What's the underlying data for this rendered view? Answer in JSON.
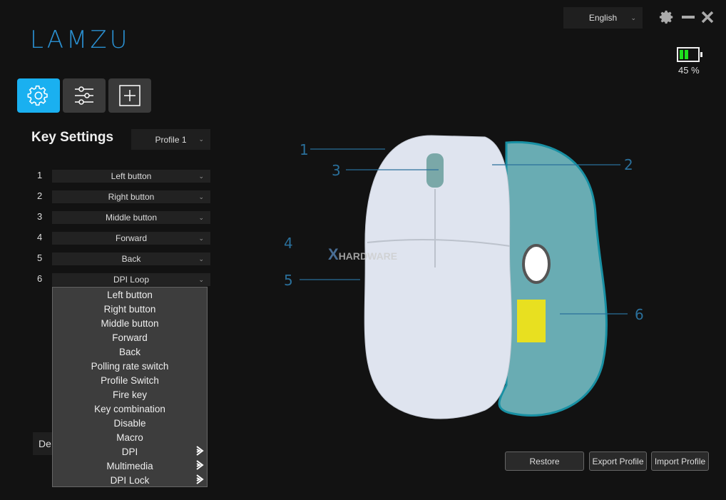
{
  "app": {
    "logo": "LAMZU"
  },
  "header": {
    "language": "English",
    "battery_percent_label": "45 %",
    "battery_level": 45,
    "battery_color": "#1ee01e"
  },
  "tabs": [
    {
      "icon": "gear-icon",
      "active": true
    },
    {
      "icon": "sliders-icon",
      "active": false
    },
    {
      "icon": "plus-box-icon",
      "active": false
    }
  ],
  "accent": "#1ab0f0",
  "key_settings": {
    "title": "Key Settings",
    "profile": "Profile 1",
    "rows": [
      {
        "num": "1",
        "value": "Left button"
      },
      {
        "num": "2",
        "value": "Right button"
      },
      {
        "num": "3",
        "value": "Middle button"
      },
      {
        "num": "4",
        "value": "Forward"
      },
      {
        "num": "5",
        "value": "Back"
      },
      {
        "num": "6",
        "value": "DPI Loop"
      }
    ],
    "default_button": "De"
  },
  "dropdown": {
    "items": [
      {
        "label": "Left button"
      },
      {
        "label": "Right button"
      },
      {
        "label": "Middle button"
      },
      {
        "label": "Forward"
      },
      {
        "label": "Back"
      },
      {
        "label": "Polling rate switch"
      },
      {
        "label": "Profile Switch"
      },
      {
        "label": "Fire key"
      },
      {
        "label": "Key combination"
      },
      {
        "label": "Disable"
      },
      {
        "label": "Macro"
      },
      {
        "label": "DPI",
        "submenu": true
      },
      {
        "label": "Multimedia",
        "submenu": true
      },
      {
        "label": "DPI Lock",
        "submenu": true
      }
    ]
  },
  "mouse": {
    "callouts": [
      "1",
      "2",
      "3",
      "4",
      "5",
      "6"
    ]
  },
  "watermark": {
    "text": "Xtreme HARDWARE"
  },
  "footer": {
    "restore": "Restore",
    "export": "Export Profile",
    "import": "Import Profile"
  }
}
